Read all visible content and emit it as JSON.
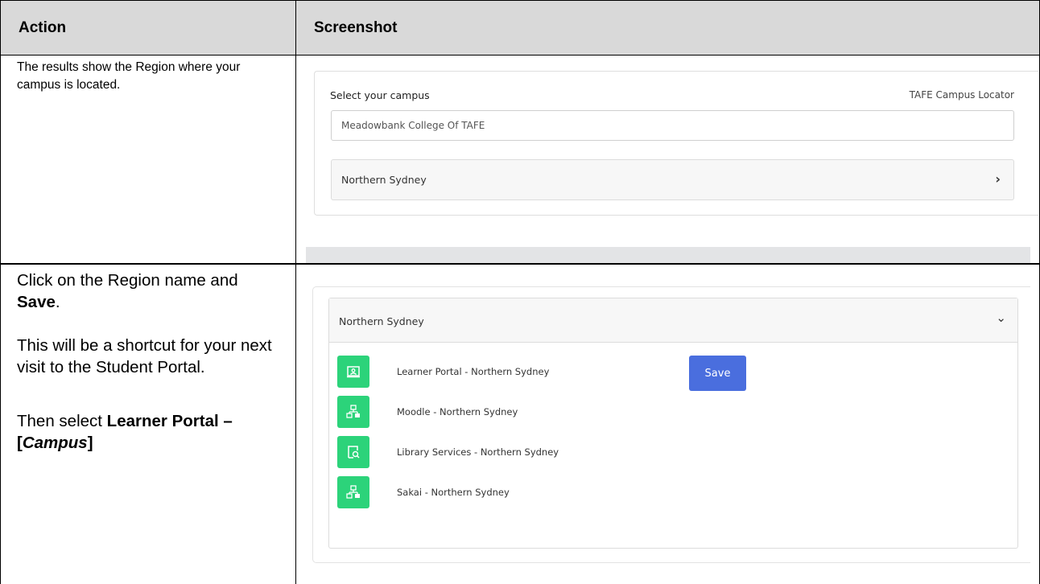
{
  "table": {
    "headers": {
      "action": "Action",
      "screenshot": "Screenshot"
    },
    "row1": {
      "action_text": "The results show the Region where your campus is located."
    },
    "row2": {
      "p1_a": "Click on the Region name and ",
      "p1_b": "Save",
      "p1_c": ".",
      "p2": "This will be a shortcut for your next visit to the Student Portal.",
      "p3_a": "Then select ",
      "p3_b": "Learner Portal – [",
      "p3_c": "Campus",
      "p3_d": "]"
    }
  },
  "shot1": {
    "label": "Select your campus",
    "locator": "TAFE Campus Locator",
    "input_value": "Meadowbank College Of TAFE",
    "region": "Northern Sydney",
    "region_icon": "chevron-right-icon"
  },
  "shot2": {
    "region": "Northern Sydney",
    "region_icon": "chevron-down-icon",
    "save_label": "Save",
    "links": [
      {
        "label": "Learner Portal - Northern Sydney",
        "icon": "learner-portal-icon"
      },
      {
        "label": "Moodle - Northern Sydney",
        "icon": "network-icon"
      },
      {
        "label": "Library Services - Northern Sydney",
        "icon": "library-search-icon"
      },
      {
        "label": "Sakai - Northern Sydney",
        "icon": "network-icon"
      }
    ],
    "tile_color": "#2cd37a",
    "save_color": "#4a6ede"
  }
}
